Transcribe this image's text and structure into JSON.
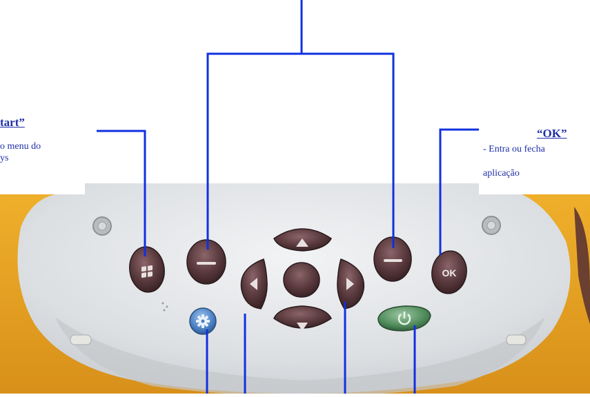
{
  "labels": {
    "start": {
      "title": "tart”",
      "desc_line1": "o menu do",
      "desc_line2": "ys"
    },
    "ok": {
      "title": "“OK”",
      "desc_line1": "- Entra ou fecha",
      "desc_line2": "aplicação"
    }
  },
  "buttons": {
    "ok_text": "OK"
  },
  "colors": {
    "callout_line": "#1030e0",
    "label_text": "#1f2fa8",
    "device_body": "#e0e2e4",
    "bezel_yellow": "#e8a21e",
    "button_dark": "#5a3a3e",
    "button_blue": "#4a7fc0",
    "power_green": "#4f8a5a"
  },
  "icons": [
    "windows-icon",
    "minus-icon",
    "triangle-up-icon",
    "triangle-down-icon",
    "triangle-left-icon",
    "triangle-right-icon",
    "settings-icon",
    "power-icon"
  ]
}
